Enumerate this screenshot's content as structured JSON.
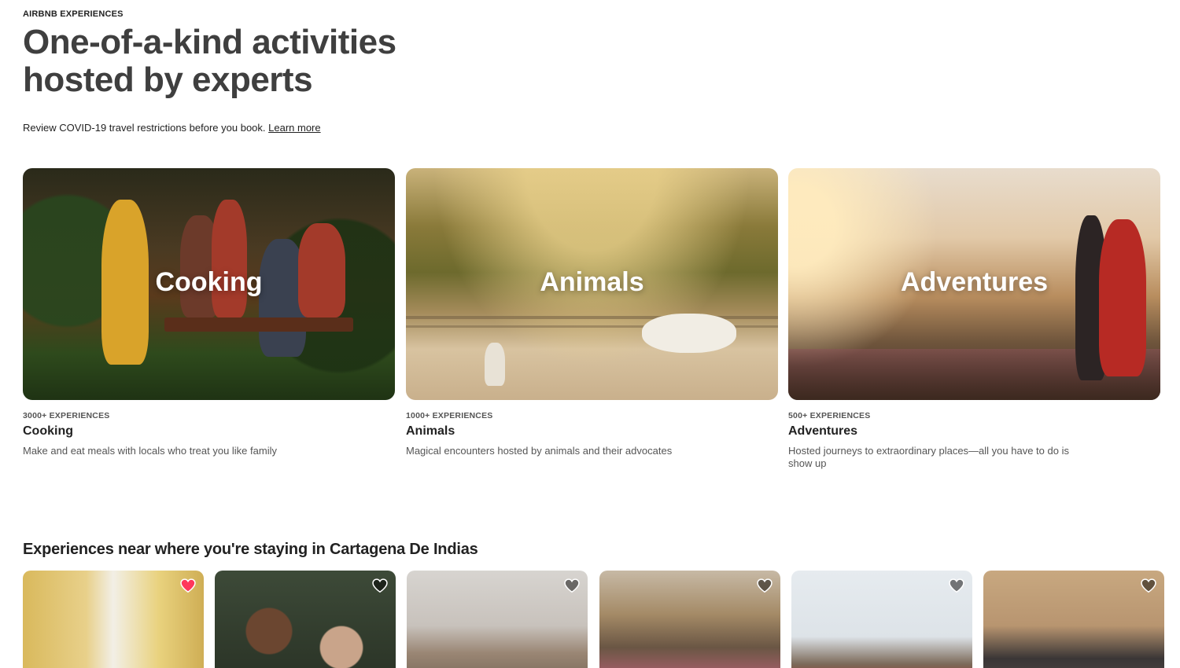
{
  "header": {
    "eyebrow": "AIRBNB EXPERIENCES",
    "title_line1": "One-of-a-kind activities",
    "title_line2": "hosted by experts",
    "notice_text": "Review COVID-19 travel restrictions before you book.",
    "notice_link": "Learn more"
  },
  "categories": [
    {
      "overlay": "Cooking",
      "count": "3000+ EXPERIENCES",
      "name": "Cooking",
      "description": "Make and eat meals with locals who treat you like family"
    },
    {
      "overlay": "Animals",
      "count": "1000+ EXPERIENCES",
      "name": "Animals",
      "description": "Magical encounters hosted by animals and their advocates"
    },
    {
      "overlay": "Adventures",
      "count": "500+ EXPERIENCES",
      "name": "Adventures",
      "description": "Hosted journeys to extraordinary places—all you have to do is show up"
    }
  ],
  "nearby": {
    "title": "Experiences near where you're staying in Cartagena De Indias",
    "cards": [
      {
        "favorited": true
      },
      {
        "favorited": false
      },
      {
        "favorited": false
      },
      {
        "favorited": false
      },
      {
        "favorited": false
      },
      {
        "favorited": false
      }
    ]
  },
  "colors": {
    "heart_active": "#ff385c",
    "heart_inactive": "#4a4a4a",
    "title_text": "#3f3f3f",
    "body_text": "#222222",
    "muted_text": "#555555"
  },
  "icons": {
    "heart": "heart-icon"
  }
}
